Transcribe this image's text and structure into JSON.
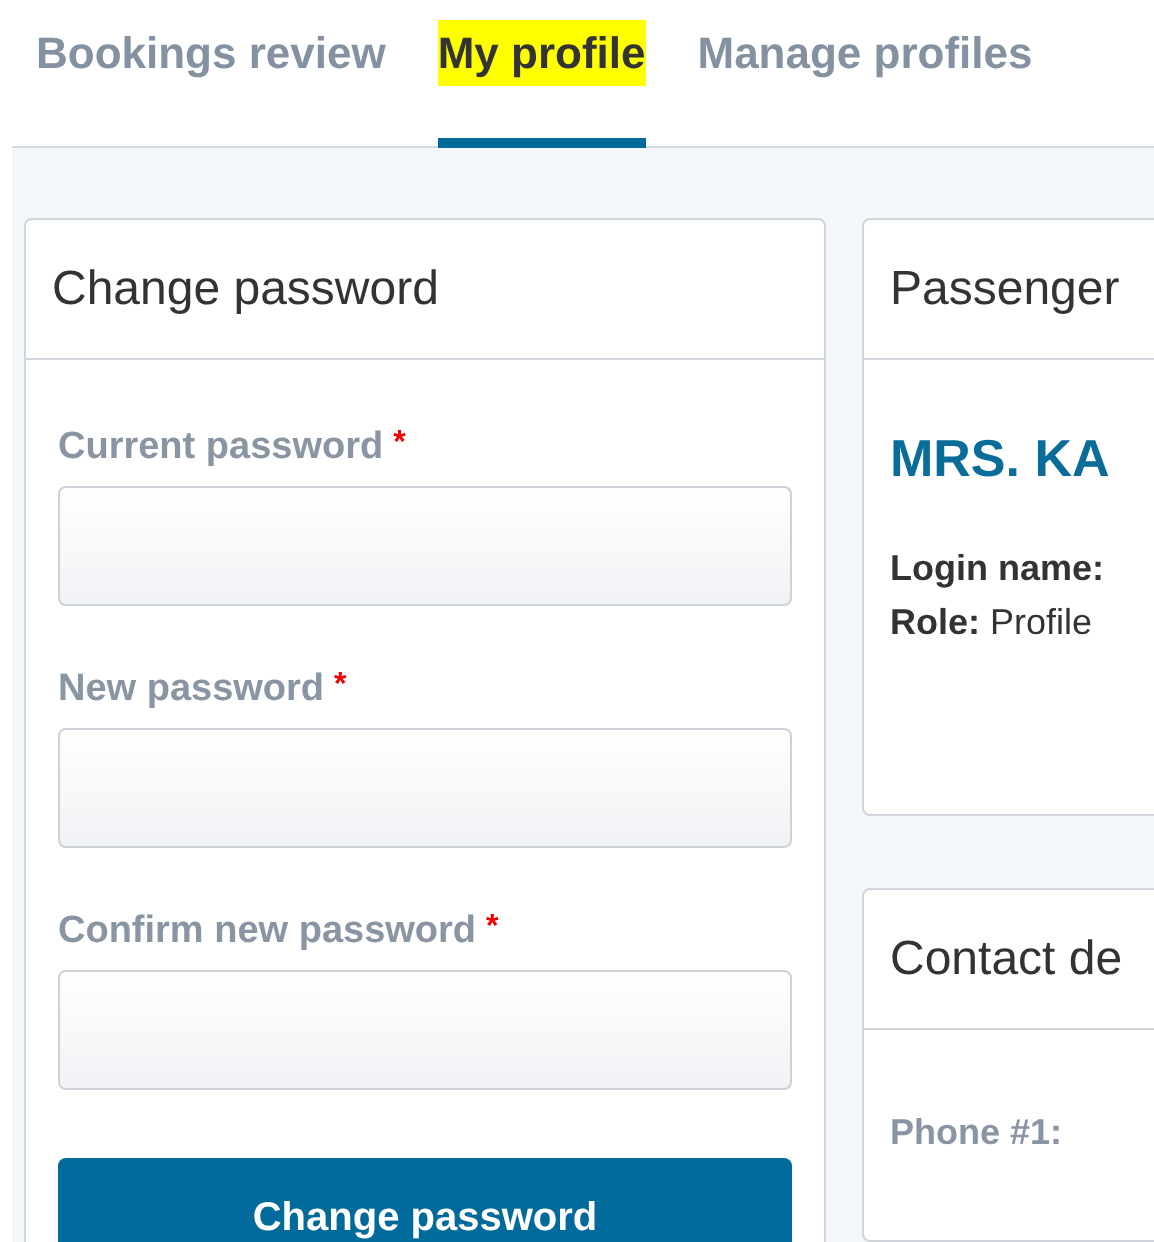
{
  "tabs": [
    {
      "label": "Bookings review",
      "selected": false,
      "highlighted": false
    },
    {
      "label": "My profile",
      "selected": true,
      "highlighted": true
    },
    {
      "label": "Manage profiles",
      "selected": false,
      "highlighted": false
    }
  ],
  "change_password": {
    "title": "Change password",
    "fields": [
      {
        "label": "Current password",
        "required": true
      },
      {
        "label": "New password",
        "required": true
      },
      {
        "label": "Confirm new password",
        "required": true
      }
    ],
    "required_mark": "*",
    "button": "Change password"
  },
  "passenger": {
    "title": "Passenger",
    "name": "MRS. KA",
    "login_label": "Login name:",
    "role": "**Role:** Profile"
  },
  "contact": {
    "title": "Contact de",
    "phone_label": "Phone #1:"
  }
}
